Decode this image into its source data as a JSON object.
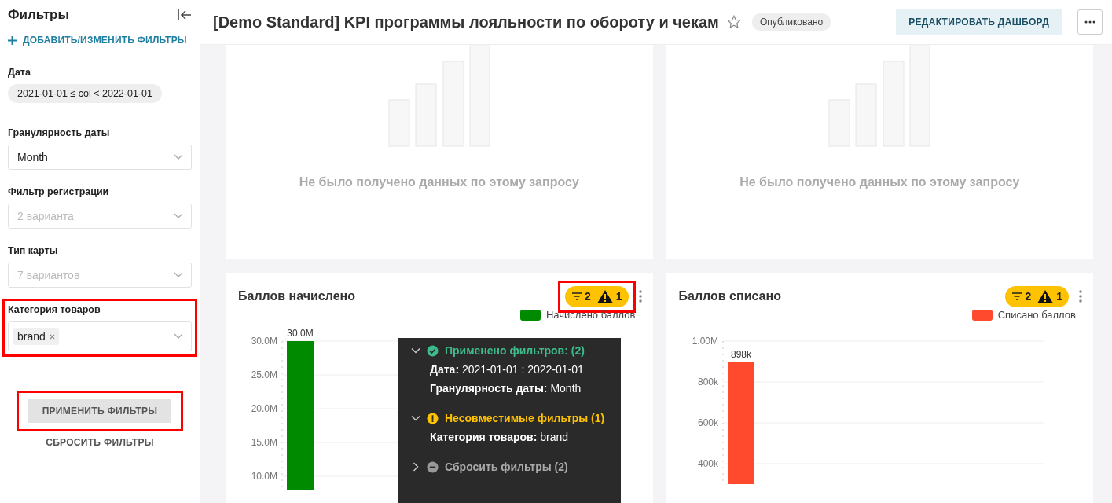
{
  "sidebar": {
    "title": "Фильтры",
    "add_filters": "ДОБАВИТЬ/ИЗМЕНИТЬ ФИЛЬТРЫ",
    "filters": [
      {
        "kind": "range",
        "label": "Дата",
        "value": "2021-01-01 ≤ col < 2022-01-01",
        "highlighted": false
      },
      {
        "kind": "select",
        "label": "Гранулярность даты",
        "value": "Month",
        "highlighted": false
      },
      {
        "kind": "select",
        "label": "Фильтр регистрации",
        "placeholder": "2 варианта",
        "highlighted": false
      },
      {
        "kind": "select",
        "label": "Тип карты",
        "placeholder": "7 вариантов",
        "highlighted": false
      },
      {
        "kind": "tags",
        "label": "Категория товаров",
        "tags": [
          "brand"
        ],
        "highlighted": true
      }
    ],
    "apply_button": {
      "label": "ПРИМЕНИТЬ ФИЛЬТРЫ",
      "highlighted": true
    },
    "reset_button": {
      "label": "СБРОСИТЬ ФИЛЬТРЫ"
    }
  },
  "header": {
    "title": "[Demo Standard] KPI программы лояльности по обороту и чекам",
    "favorite": false,
    "status": "Опубликовано",
    "edit_button": "РЕДАКТИРОВАТЬ ДАШБОРД"
  },
  "cards": [
    {
      "kind": "empty",
      "message": "Не было получено данных по этому запросу"
    },
    {
      "kind": "empty",
      "message": "Не было получено данных по этому запросу"
    },
    {
      "kind": "chart",
      "title": "Баллов начислено",
      "badge": {
        "filters": "2",
        "warnings": "1",
        "highlighted": true
      },
      "chart_data": {
        "type": "bar",
        "grid": true,
        "ylim": [
          8000000,
          30000000
        ],
        "series": [
          {
            "name": "Начислено баллов",
            "color": "#008a00",
            "values": [
              30000000
            ]
          }
        ],
        "yticks": [
          {
            "value": 10000000,
            "label": "10.0M"
          },
          {
            "value": 15000000,
            "label": "15.0M"
          },
          {
            "value": 20000000,
            "label": "20.0M"
          },
          {
            "value": 25000000,
            "label": "25.0M"
          },
          {
            "value": 30000000,
            "label": "30.0M"
          }
        ],
        "value_labels": [
          "30.0M"
        ]
      }
    },
    {
      "kind": "chart",
      "title": "Баллов списано",
      "badge": {
        "filters": "2",
        "warnings": "1",
        "highlighted": false
      },
      "chart_data": {
        "type": "bar",
        "grid": true,
        "ylim": [
          300000,
          1000000
        ],
        "series": [
          {
            "name": "Списано баллов",
            "color": "#ff4a2e",
            "values": [
              898000
            ]
          }
        ],
        "yticks": [
          {
            "value": 400000,
            "label": "400k"
          },
          {
            "value": 600000,
            "label": "600k"
          },
          {
            "value": 800000,
            "label": "800k"
          },
          {
            "value": 1000000,
            "label": "1.00M"
          }
        ],
        "value_labels": [
          "898k"
        ]
      }
    }
  ],
  "popup": {
    "sections": [
      {
        "kind": "ok",
        "title": "Применено фильтров: (2)",
        "expanded": true,
        "items": [
          "**Дата:** 2021-01-01 : 2022-01-01",
          "**Гранулярность даты:** Month"
        ]
      },
      {
        "kind": "warning",
        "title": "Несовместимые фильтры (1)",
        "expanded": true,
        "items": [
          "**Категория товаров:** brand"
        ]
      },
      {
        "kind": "neutral",
        "title": "Сбросить фильтры (2)",
        "expanded": false
      }
    ]
  }
}
